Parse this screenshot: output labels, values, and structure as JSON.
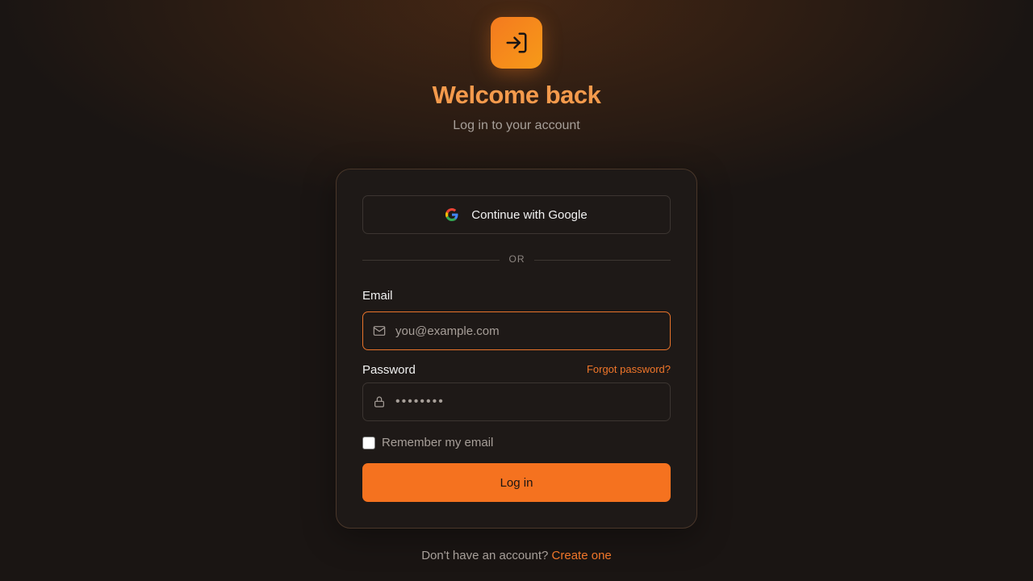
{
  "header": {
    "logo_icon": "login-arrow-icon",
    "title": "Welcome back",
    "subtitle": "Log in to your account"
  },
  "card": {
    "google_button_label": "Continue with Google",
    "google_icon": "google-logo-icon",
    "divider_text": "OR",
    "email": {
      "label": "Email",
      "placeholder": "you@example.com",
      "value": "",
      "icon": "mail-icon",
      "focused": true
    },
    "password": {
      "label": "Password",
      "forgot_label": "Forgot password?",
      "value": "••••••••",
      "icon": "lock-icon"
    },
    "remember": {
      "label": "Remember my email",
      "checked": false
    },
    "login_button_label": "Log in"
  },
  "footer": {
    "prompt": "Don't have an account?",
    "link_label": "Create one"
  },
  "colors": {
    "accent": "#f5721f",
    "title": "#f49a4c",
    "background": "#1a1513",
    "card_border": "#4a372a"
  }
}
